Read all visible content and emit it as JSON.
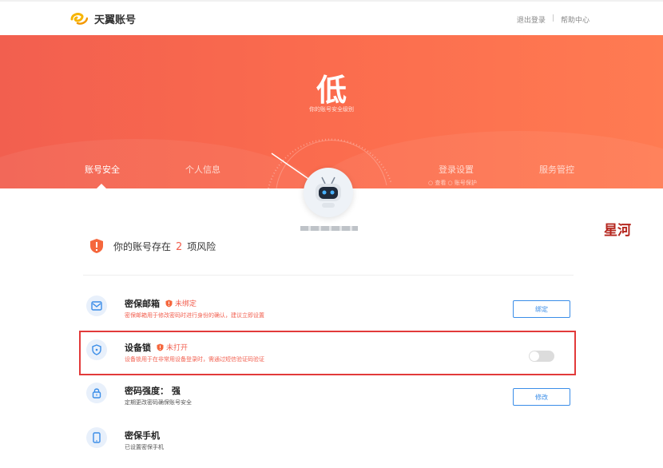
{
  "header": {
    "brand": "天翼账号",
    "logout": "退出登录",
    "separator": "|",
    "help": "帮助中心"
  },
  "banner": {
    "level": "低",
    "level_caption": "你的账号安全级别",
    "tabs": [
      "账号安全",
      "个人信息",
      "登录设置",
      "服务管控"
    ],
    "sub_links": "○ 查看  ○ 账号保护"
  },
  "watermark": "星河",
  "risk": {
    "prefix": "你的账号存在",
    "count": "2",
    "suffix": "项风险"
  },
  "items": [
    {
      "title": "密保邮箱",
      "status": "未绑定",
      "desc": "密保邮箱用于修改密码时进行身份的确认，建议立即设置",
      "button": "绑定",
      "icon": "mail-icon"
    },
    {
      "title": "设备锁",
      "status": "未打开",
      "desc": "设备锁用于在非常用设备登录时，需通过短信验证码验证",
      "toggle_on": false,
      "icon": "shield-lock-icon"
    },
    {
      "title": "密码强度：",
      "strength": "强",
      "desc": "定期更改密码确保账号安全",
      "button": "修改",
      "icon": "lock-icon"
    },
    {
      "title": "密保手机",
      "desc": "已设置密保手机",
      "icon": "phone-icon"
    }
  ],
  "colors": {
    "accent": "#f25f4f",
    "link": "#3a8de8",
    "highlight": "#e23a3a"
  }
}
